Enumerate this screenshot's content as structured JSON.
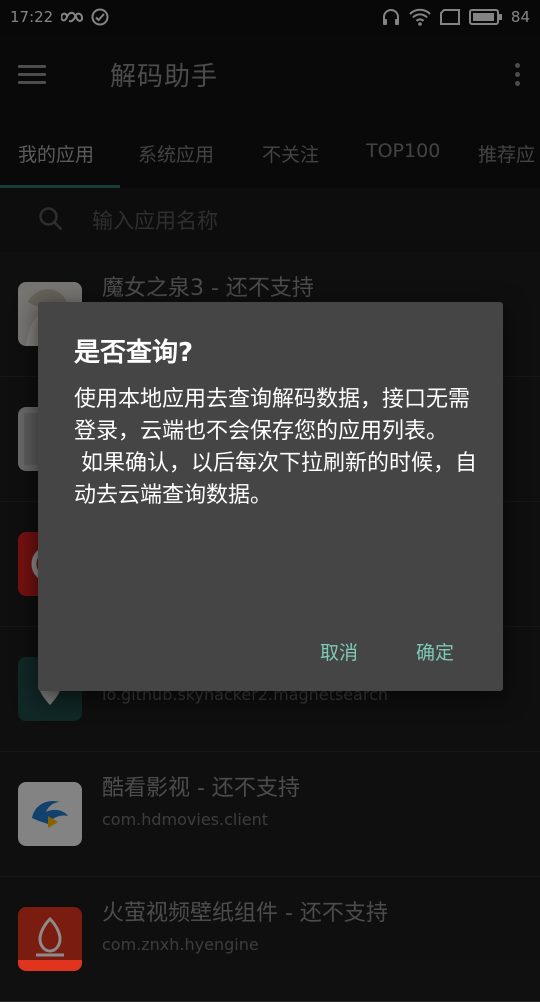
{
  "status_bar": {
    "time": "17:22",
    "battery": "84"
  },
  "toolbar": {
    "title": "解码助手"
  },
  "tabs": [
    "我的应用",
    "系统应用",
    "不关注",
    "TOP100",
    "推荐应"
  ],
  "search": {
    "placeholder": "输入应用名称"
  },
  "apps": [
    {
      "title": "魔女之泉3 - 还不支持",
      "package": ""
    },
    {
      "title": "",
      "package": ""
    },
    {
      "title": "",
      "package": ""
    },
    {
      "title": "",
      "package": "io.github.skyhacker2.magnetsearch"
    },
    {
      "title": "酷看影视 - 还不支持",
      "package": "com.hdmovies.client"
    },
    {
      "title": "火萤视频壁纸组件 - 还不支持",
      "package": "com.znxh.hyengine"
    }
  ],
  "dialog": {
    "title": "是否查询?",
    "body": "使用本地应用去查询解码数据，接口无需登录，云端也不会保存您的应用列表。\n 如果确认，以后每次下拉刷新的时候，自动去云端查询数据。",
    "cancel": "取消",
    "confirm": "确定"
  },
  "colors": {
    "accent": "#7fc9b7",
    "dialog_bg": "#454545",
    "tab_indicator": "#2f6f66"
  }
}
